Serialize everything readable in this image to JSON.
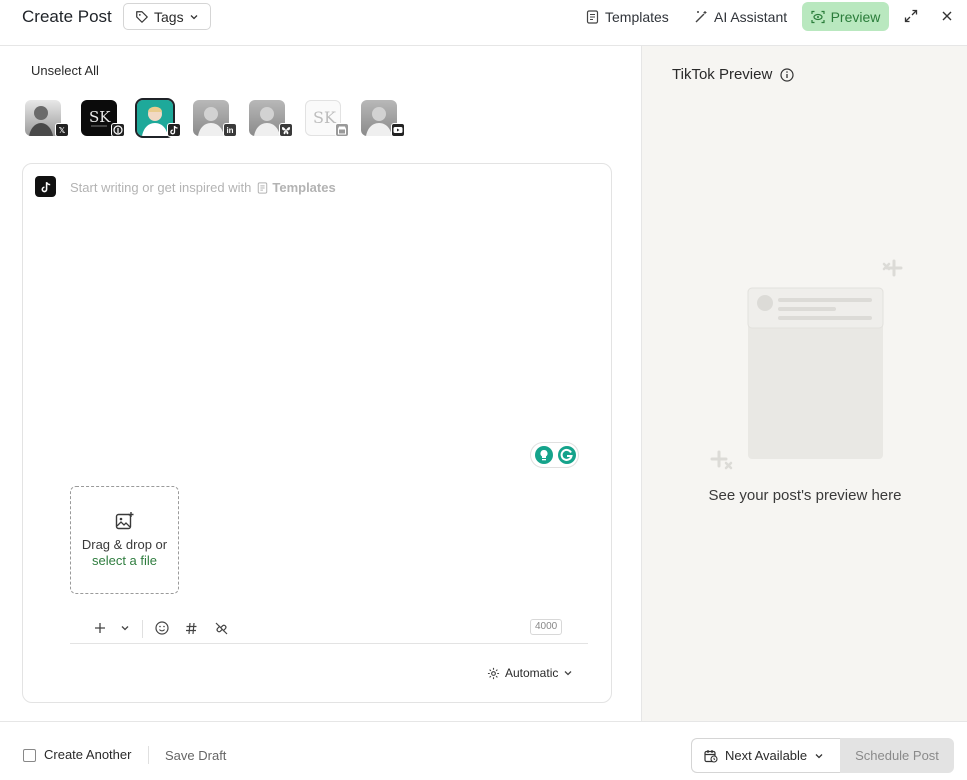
{
  "header": {
    "title": "Create Post",
    "tags_label": "Tags",
    "templates_label": "Templates",
    "ai_label": "AI Assistant",
    "preview_label": "Preview",
    "preview_bg": "#b9e8bf"
  },
  "accounts": {
    "unselect_label": "Unselect All",
    "items": [
      {
        "network": "x",
        "selected": false
      },
      {
        "network": "pinterest",
        "selected": false
      },
      {
        "network": "tiktok",
        "selected": true
      },
      {
        "network": "linkedin",
        "selected": false
      },
      {
        "network": "bluesky",
        "selected": false
      },
      {
        "network": "google-business",
        "selected": false
      },
      {
        "network": "youtube",
        "selected": false
      }
    ]
  },
  "editor": {
    "placeholder": "Start writing or get inspired with",
    "templates_link": "Templates",
    "dropzone_text": "Drag & drop or",
    "dropzone_link": "select a file",
    "char_count": "4000",
    "automatic_label": "Automatic"
  },
  "preview_panel": {
    "title": "TikTok Preview",
    "empty_text": "See your post's preview here"
  },
  "footer": {
    "create_another_label": "Create Another",
    "save_draft_label": "Save Draft",
    "next_available_label": "Next Available",
    "schedule_label": "Schedule Post"
  }
}
